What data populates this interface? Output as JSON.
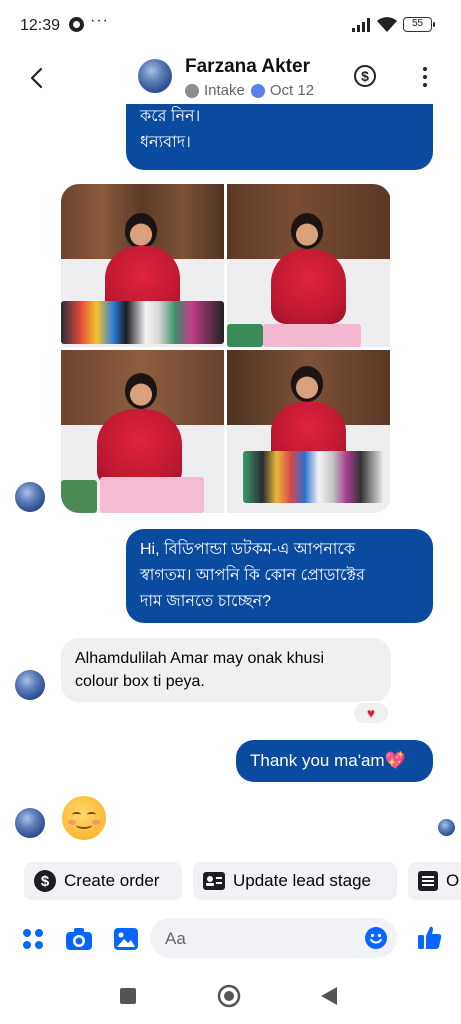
{
  "status_bar": {
    "time": "12:39",
    "dots": "···",
    "battery": "55"
  },
  "header": {
    "name": "Farzana Akter",
    "stage": "Intake",
    "date": "Oct 12"
  },
  "messages": {
    "top_partial_line1": "করে নিন।",
    "top_partial_line2": "ধন্যবাদ।",
    "greeting_line1": "Hi, বিডিপান্ডা ডটকম-এ আপনাকে",
    "greeting_line2": "স্বাগতম। আপনি কি কোন প্রোডাক্টের",
    "greeting_line3": "দাম জানতে চাচ্ছেন?",
    "customer_line1": "Alhamdulilah Amar may onak khusi",
    "customer_line2": "colour box ti peya.",
    "reaction": "♥",
    "thanks": "Thank you ma'am💖",
    "emoji": "☺"
  },
  "actions": {
    "create_order": "Create order",
    "update_lead_stage": "Update lead stage",
    "third": "O"
  },
  "composer": {
    "placeholder": "Aa"
  },
  "colors": {
    "accent": "#0a4b9f",
    "messenger_blue": "#0866ff",
    "bubble_gray": "#f0f0f0"
  }
}
